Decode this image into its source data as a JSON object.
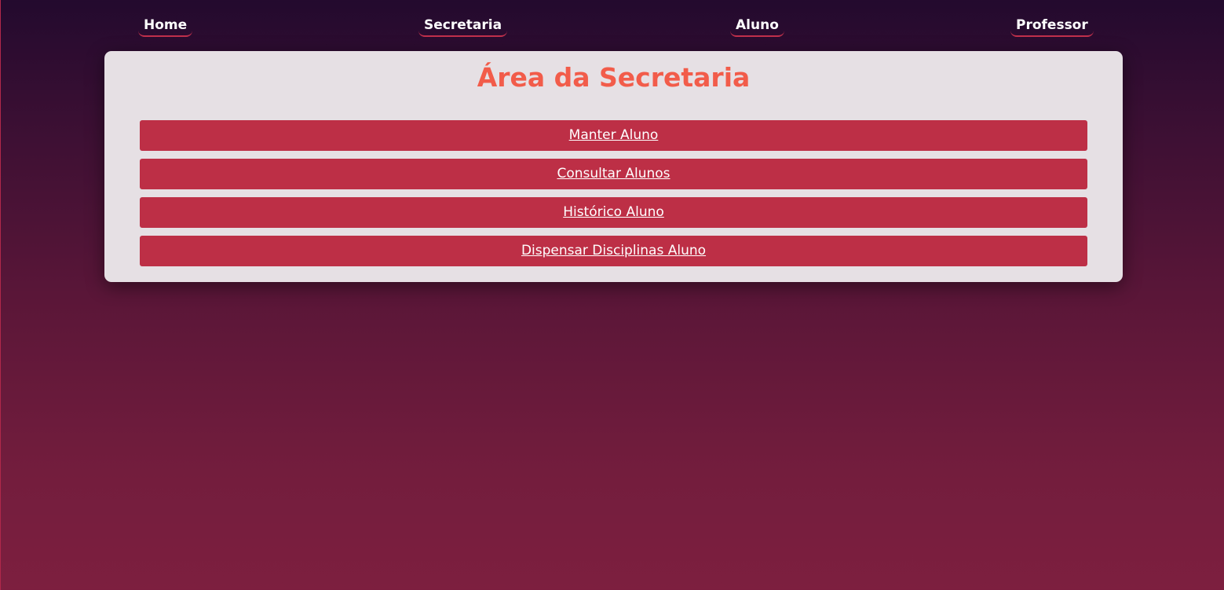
{
  "nav": {
    "items": [
      {
        "label": "Home"
      },
      {
        "label": "Secretaria"
      },
      {
        "label": "Aluno"
      },
      {
        "label": "Professor"
      }
    ]
  },
  "panel": {
    "title": "Área da Secretaria",
    "buttons": [
      {
        "label": "Manter Aluno"
      },
      {
        "label": "Consultar Alunos"
      },
      {
        "label": "Histórico Aluno"
      },
      {
        "label": "Dispensar Disciplinas Aluno"
      }
    ]
  },
  "colors": {
    "title": "#f25c4a",
    "button_bg": "#bd2f46",
    "panel_bg": "#e6e0e4",
    "nav_underline": "#c0304c"
  }
}
